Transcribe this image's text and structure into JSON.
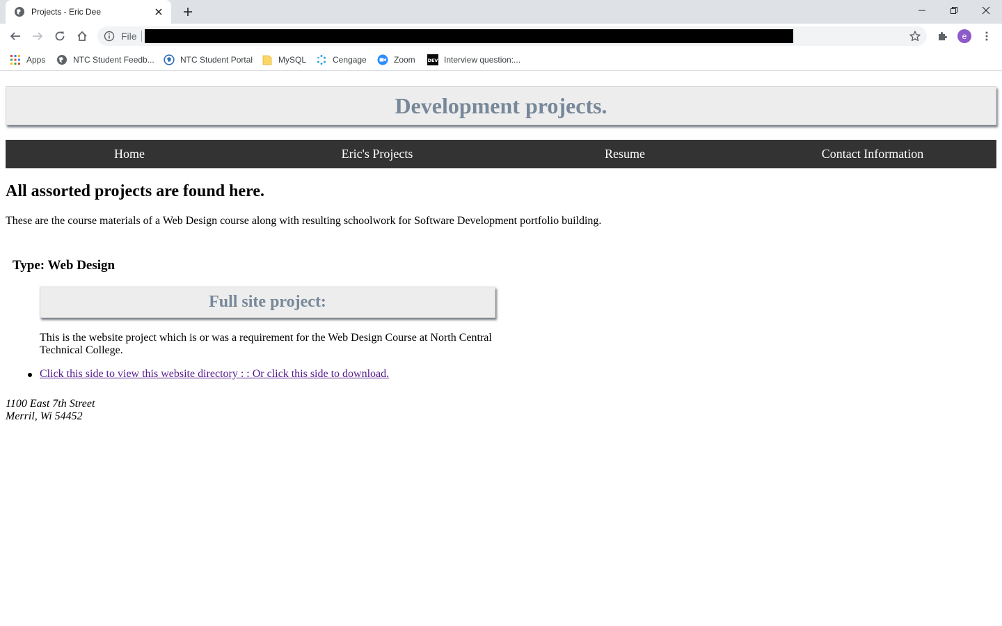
{
  "browser": {
    "tab_title": "Projects - Eric Dee",
    "omnibox_scheme": "File",
    "profile_initial": "e",
    "bookmarks": [
      {
        "label": "Apps",
        "icon": "apps-grid-icon"
      },
      {
        "label": "NTC Student Feedb...",
        "icon": "globe-icon"
      },
      {
        "label": "NTC Student Portal",
        "icon": "portal-globe-icon"
      },
      {
        "label": "MySQL",
        "icon": "folder-icon"
      },
      {
        "label": "Cengage",
        "icon": "cengage-icon"
      },
      {
        "label": "Zoom",
        "icon": "zoom-icon"
      },
      {
        "label": "Interview question:...",
        "icon": "dev-icon"
      }
    ]
  },
  "page": {
    "banner_title": "Development projects.",
    "nav": [
      "Home",
      "Eric's Projects",
      "Resume",
      "Contact Information"
    ],
    "heading": "All assorted projects are found here.",
    "intro": "These are the course materials of a Web Design course along with resulting schoolwork for Software Development portfolio building.",
    "type_heading": "Type: Web Design",
    "card_title": "Full site project:",
    "card_description": "This is the website project which is or was a requirement for the Web Design Course at North Central Technical College.",
    "link_text": "Click this side to view this website directory : : Or click this side to download.",
    "address_line1": "1100 East 7th Street",
    "address_line2": "Merril, Wi 54452"
  }
}
